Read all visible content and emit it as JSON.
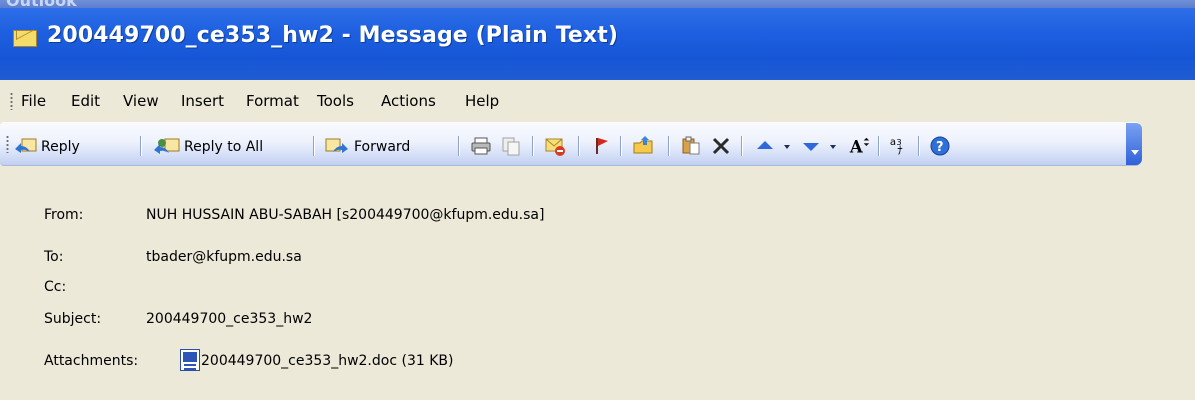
{
  "app_name": "Outlook",
  "window": {
    "title": "200449700_ce353_hw2 - Message (Plain Text)"
  },
  "menu": [
    "File",
    "Edit",
    "View",
    "Insert",
    "Format",
    "Tools",
    "Actions",
    "Help"
  ],
  "toolbar": {
    "reply_label": "Reply",
    "reply_all_label": "Reply to All",
    "forward_label": "Forward",
    "icons": [
      "print-icon",
      "copy-icon",
      "delete-mail-icon",
      "flag-icon",
      "move-to-folder-icon",
      "paste-icon",
      "delete-x-icon",
      "previous-item-icon",
      "next-item-icon",
      "font-size-icon",
      "encoding-icon",
      "help-icon"
    ]
  },
  "header": {
    "from_label": "From:",
    "from_value": "NUH HUSSAIN ABU-SABAH [s200449700@kfupm.edu.sa]",
    "to_label": "To:",
    "to_value": "tbader@kfupm.edu.sa",
    "cc_label": "Cc:",
    "cc_value": "",
    "subject_label": "Subject:",
    "subject_value": "200449700_ce353_hw2",
    "attachments_label": "Attachments:",
    "attachment_value": "200449700_ce353_hw2.doc (31 KB)"
  },
  "colors": {
    "titlebar": "#1D5FE0",
    "background": "#ECE9D8",
    "toolbar_top": "#FAFBFF",
    "toolbar_bottom": "#C1CFF0"
  }
}
